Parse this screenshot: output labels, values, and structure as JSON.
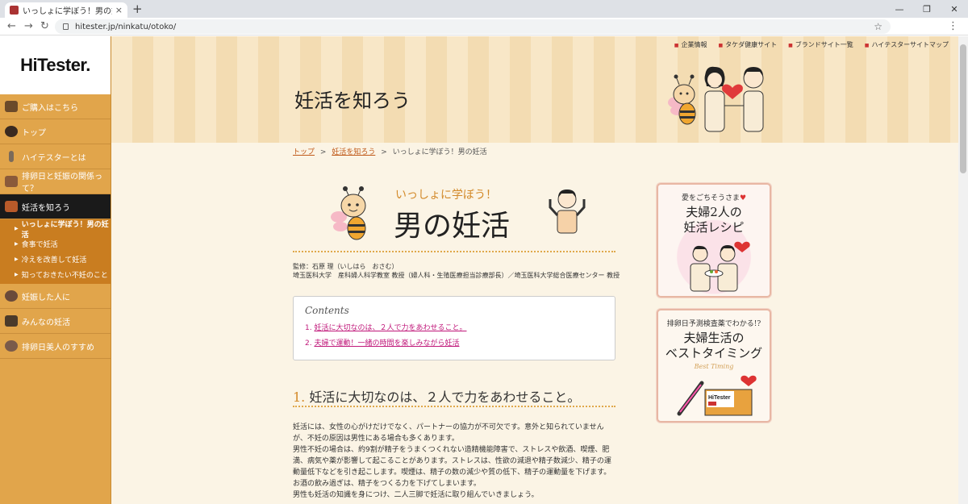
{
  "browser": {
    "tab_title": "いっしょに学ぼう！男の妊活：タケダ",
    "tab_close": "×",
    "new_tab": "+",
    "url": "hitester.jp/ninkatu/otoko/",
    "win_min": "—",
    "win_max": "❐",
    "win_close": "✕",
    "back": "←",
    "forward": "→",
    "reload": "↻",
    "star": "☆",
    "menu": "⋮"
  },
  "sidebar": {
    "logo": "HiTester.",
    "items": [
      {
        "label": "ご購入はこちら"
      },
      {
        "label": "トップ"
      },
      {
        "label": "ハイテスターとは"
      },
      {
        "label": "排卵日と妊娠の関係って？"
      },
      {
        "label": "妊活を知ろう"
      }
    ],
    "subitems": [
      {
        "label": "いっしょに学ぼう！男の妊活"
      },
      {
        "label": "食事で妊活"
      },
      {
        "label": "冷えを改善して妊活"
      },
      {
        "label": "知っておきたい不妊のこと"
      }
    ],
    "items2": [
      {
        "label": "妊娠した人に"
      },
      {
        "label": "みんなの妊活"
      },
      {
        "label": "排卵日美人のすすめ"
      }
    ]
  },
  "toplinks": [
    "企業情報",
    "タケダ健康サイト",
    "ブランドサイト一覧",
    "ハイテスターサイトマップ"
  ],
  "banner": {
    "title": "妊活を知ろう"
  },
  "breadcrumb": {
    "home": "トップ",
    "sep": ">",
    "parent": "妊活を知ろう",
    "current": "いっしょに学ぼう！男の妊活"
  },
  "hero": {
    "subtitle": "いっしょに学ぼう！",
    "title": "男の妊活"
  },
  "supervisor": {
    "line1": "監修：石原 理（いしはら　おさむ）",
    "line2": "埼玉医科大学　産科婦人科学教室 教授（婦人科・生殖医療担当診療部長）／埼玉医科大学総合医療センター 教授"
  },
  "contents": {
    "heading": "Contents",
    "items": [
      {
        "num": "1.",
        "label": "妊活に大切なのは、２人で力をあわせること。"
      },
      {
        "num": "2.",
        "label": "夫婦で運動！一緒の時間を楽しみながら妊活"
      }
    ]
  },
  "section1": {
    "num": "1.",
    "title": "妊活に大切なのは、２人で力をあわせること。",
    "paragraphs": [
      "妊活には、女性の心がけだけでなく、パートナーの協力が不可欠です。意外と知られていませんが、不妊の原因は男性にある場合も多くあります。",
      "男性不妊の場合は、約9割が精子をうまくつくれない造精機能障害で、ストレスや飲酒、喫煙、肥満、病気や薬が影響して起こることがあります。ストレスは、性欲の減退や精子数減少、精子の運動量低下などを引き起こします。喫煙は、精子の数の減少や質の低下、精子の運動量を下げます。お酒の飲み過ぎは、精子をつくる力を下げてしまいます。",
      "男性も妊活の知識を身につけ、二人三脚で妊活に取り組んでいきましょう。"
    ]
  },
  "cards": [
    {
      "small": "愛をごちそうさま",
      "heart": "♥",
      "big1": "夫婦2人の",
      "big2": "妊活レシピ"
    },
    {
      "small": "排卵日予測検査薬でわかる!?",
      "big1": "夫婦生活の",
      "big2": "ベストタイミング",
      "en": "Best Timing",
      "box": "HiTester"
    }
  ],
  "colors": {
    "sidebar": "#e1a54b",
    "accent": "#d38a2a",
    "link": "#c0187a",
    "active": "#1a1a1a"
  }
}
